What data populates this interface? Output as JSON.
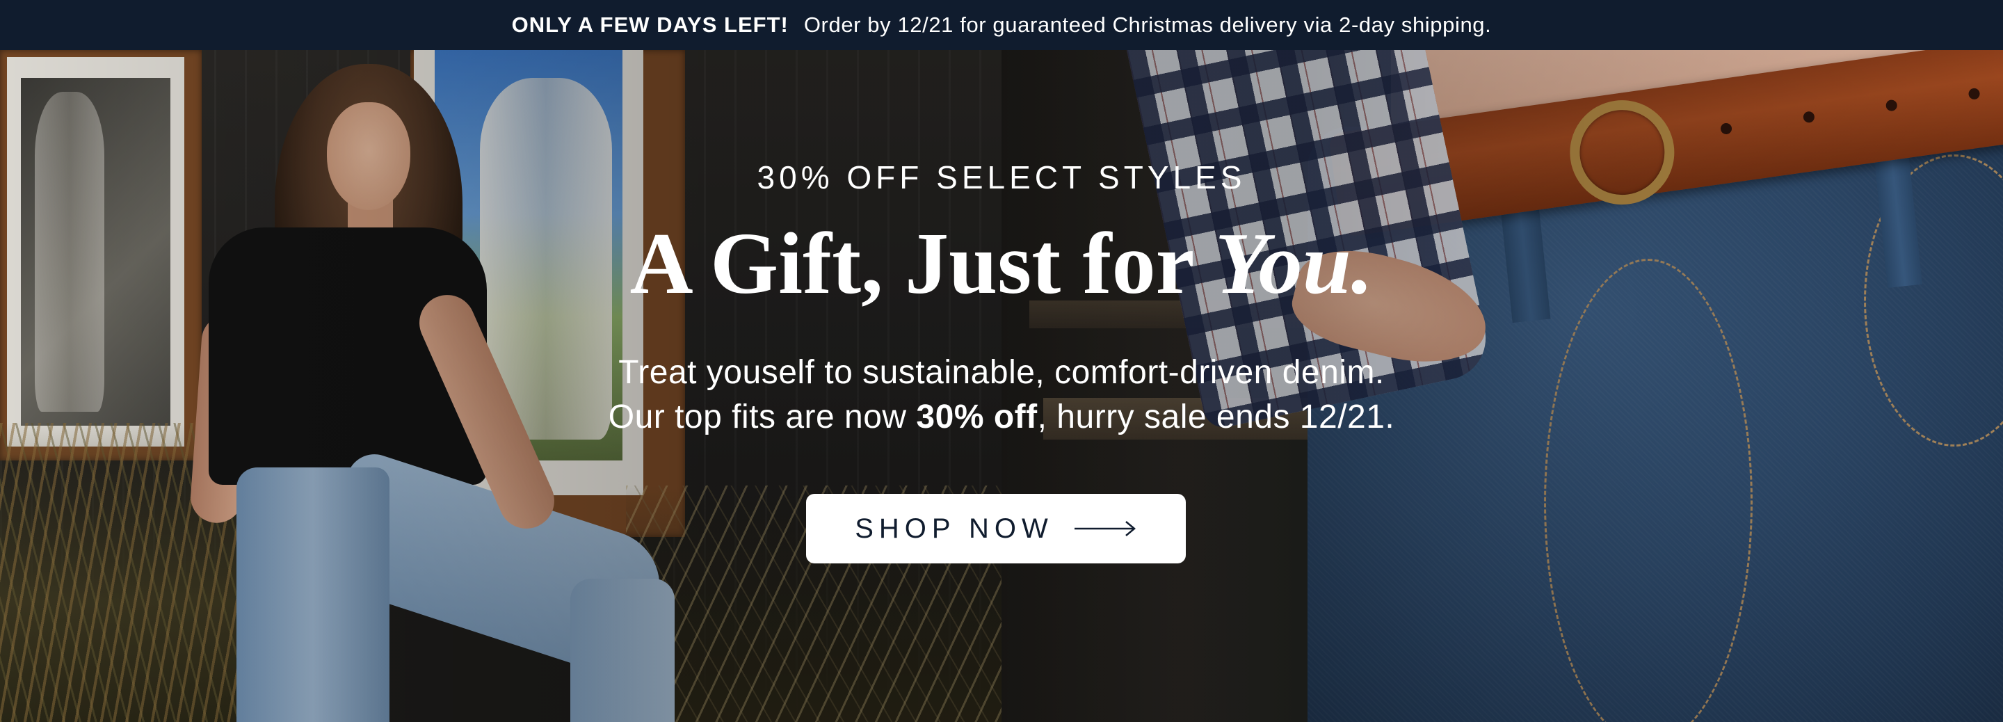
{
  "announcement": {
    "highlight": "ONLY A FEW DAYS LEFT!",
    "message": "Order by 12/21 for guaranteed Christmas delivery via 2-day shipping."
  },
  "hero": {
    "eyebrow": "30% OFF SELECT STYLES",
    "headline_main": "A Gift, Just for ",
    "headline_italic": "You.",
    "body_line1": "Treat youself to sustainable, comfort-driven denim.",
    "body_line2_pre": "Our top fits are now ",
    "body_line2_bold": "30% off",
    "body_line2_post": ",  hurry sale ends 12/21.",
    "cta_label": "SHOP NOW",
    "cta_icon": "arrow-right-icon"
  },
  "colors": {
    "announcement_bg": "#101c2e",
    "text_light": "#ffffff",
    "cta_bg": "#ffffff",
    "cta_text": "#101c2e"
  }
}
